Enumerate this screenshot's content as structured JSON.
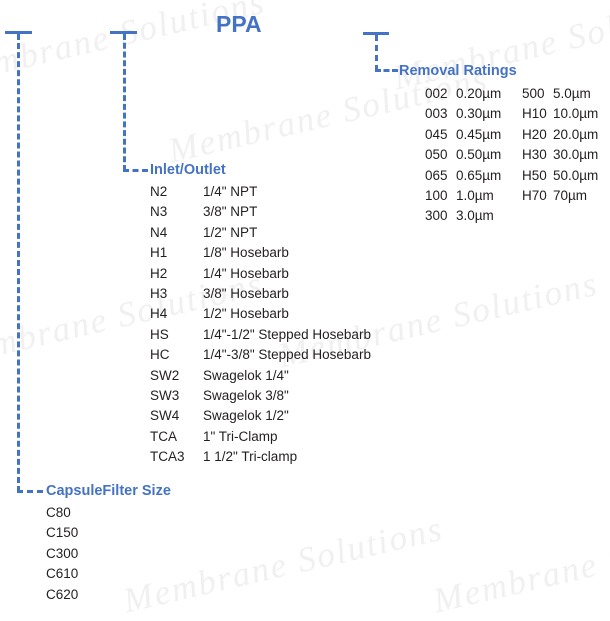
{
  "title": "PPA",
  "colors": {
    "accent": "#4472C4",
    "text": "#231F20",
    "watermark": "#F0F0F2",
    "background": "#FFFFFF"
  },
  "watermark": {
    "text": "Membrane Solutions"
  },
  "branches": {
    "capsule_filter_size": {
      "label": "CapsuleFilter Size",
      "options": [
        {
          "code": "C80",
          "desc": ""
        },
        {
          "code": "C150",
          "desc": ""
        },
        {
          "code": "C300",
          "desc": ""
        },
        {
          "code": "C610",
          "desc": ""
        },
        {
          "code": "C620",
          "desc": ""
        }
      ]
    },
    "inlet_outlet": {
      "label": "Inlet/Outlet",
      "options": [
        {
          "code": "N2",
          "desc": "1/4\" NPT"
        },
        {
          "code": "N3",
          "desc": "3/8\" NPT"
        },
        {
          "code": "N4",
          "desc": "1/2\" NPT"
        },
        {
          "code": "H1",
          "desc": "1/8\" Hosebarb"
        },
        {
          "code": "H2",
          "desc": "1/4\" Hosebarb"
        },
        {
          "code": "H3",
          "desc": "3/8\" Hosebarb"
        },
        {
          "code": "H4",
          "desc": "1/2\" Hosebarb"
        },
        {
          "code": "HS",
          "desc": "1/4\"-1/2\" Stepped Hosebarb"
        },
        {
          "code": "HC",
          "desc": "1/4\"-3/8\" Stepped Hosebarb"
        },
        {
          "code": "SW2",
          "desc": "Swagelok 1/4\""
        },
        {
          "code": "SW3",
          "desc": "Swagelok 3/8\""
        },
        {
          "code": "SW4",
          "desc": "Swagelok 1/2\""
        },
        {
          "code": "TCA",
          "desc": "1\" Tri-Clamp"
        },
        {
          "code": "TCA3",
          "desc": "1 1/2\" Tri-clamp"
        }
      ]
    },
    "removal_ratings": {
      "label": "Removal Ratings",
      "column1": [
        {
          "code": "002",
          "desc": "0.20µm"
        },
        {
          "code": "003",
          "desc": "0.30µm"
        },
        {
          "code": "045",
          "desc": "0.45µm"
        },
        {
          "code": "050",
          "desc": "0.50µm"
        },
        {
          "code": "065",
          "desc": "0.65µm"
        },
        {
          "code": "100",
          "desc": "1.0µm"
        },
        {
          "code": "300",
          "desc": "3.0µm"
        }
      ],
      "column2": [
        {
          "code": "500",
          "desc": "5.0µm"
        },
        {
          "code": "H10",
          "desc": "10.0µm"
        },
        {
          "code": "H20",
          "desc": "20.0µm"
        },
        {
          "code": "H30",
          "desc": "30.0µm"
        },
        {
          "code": "H50",
          "desc": "50.0µm"
        },
        {
          "code": "H70",
          "desc": "70µm"
        }
      ]
    }
  }
}
